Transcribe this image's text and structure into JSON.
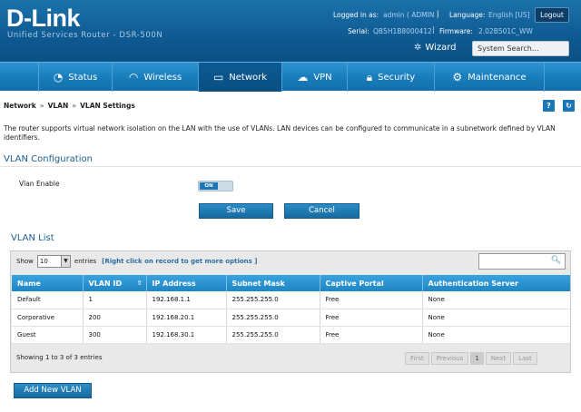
{
  "header": {
    "logo": "D-Link",
    "subtitle": "Unified Services Router - DSR-500N",
    "logged_label": "Logged in as:",
    "logged_value": "admin ( ADMIN )",
    "language_label": "Language:",
    "language_value": "English [US]",
    "logout": "Logout",
    "serial_label": "Serial:",
    "serial_value": "QB5H1B8000412",
    "firmware_label": "Firmware:",
    "firmware_value": "2.02B501C_WW",
    "wizard": "Wizard",
    "search_placeholder": "System Search..."
  },
  "nav": [
    {
      "label": "Status",
      "icon": "gauge-icon"
    },
    {
      "label": "Wireless",
      "icon": "wifi-icon"
    },
    {
      "label": "Network",
      "icon": "monitor-icon"
    },
    {
      "label": "VPN",
      "icon": "cloud-icon"
    },
    {
      "label": "Security",
      "icon": "lock-icon"
    },
    {
      "label": "Maintenance",
      "icon": "gear-icon"
    }
  ],
  "breadcrumb": [
    "Network",
    "VLAN",
    "VLAN Settings"
  ],
  "breadcrumb_sep": "»",
  "description": "The router supports virtual network isolation on the LAN with the use of VLANs. LAN devices can be configured to communicate in a subnetwork defined by VLAN identifiers.",
  "config": {
    "title": "VLAN Configuration",
    "vlan_enable_label": "Vlan Enable",
    "toggle_state": "ON",
    "save": "Save",
    "cancel": "Cancel"
  },
  "list": {
    "title": "VLAN List",
    "show_label": "Show",
    "entries_value": "10",
    "entries_label": "entries",
    "hint": "[Right click on record to get more options ]",
    "columns": [
      "Name",
      "VLAN ID",
      "IP Address",
      "Subnet Mask",
      "Captive Portal",
      "Authentication Server"
    ],
    "rows": [
      [
        "Default",
        "1",
        "192.168.1.1",
        "255.255.255.0",
        "Free",
        "None"
      ],
      [
        "Corporative",
        "200",
        "192.168.20.1",
        "255.255.255.0",
        "Free",
        "None"
      ],
      [
        "Guest",
        "300",
        "192.168.30.1",
        "255.255.255.0",
        "Free",
        "None"
      ]
    ],
    "info": "Showing 1 to 3 of 3 entries",
    "pager": {
      "first": "First",
      "previous": "Previous",
      "page": "1",
      "next": "Next",
      "last": "Last"
    },
    "add_button": "Add New VLAN"
  },
  "colors": {
    "header": "#1467a1",
    "nav": "#1f82c2",
    "nav_active": "#0b5188",
    "accent": "#1a76b4"
  }
}
